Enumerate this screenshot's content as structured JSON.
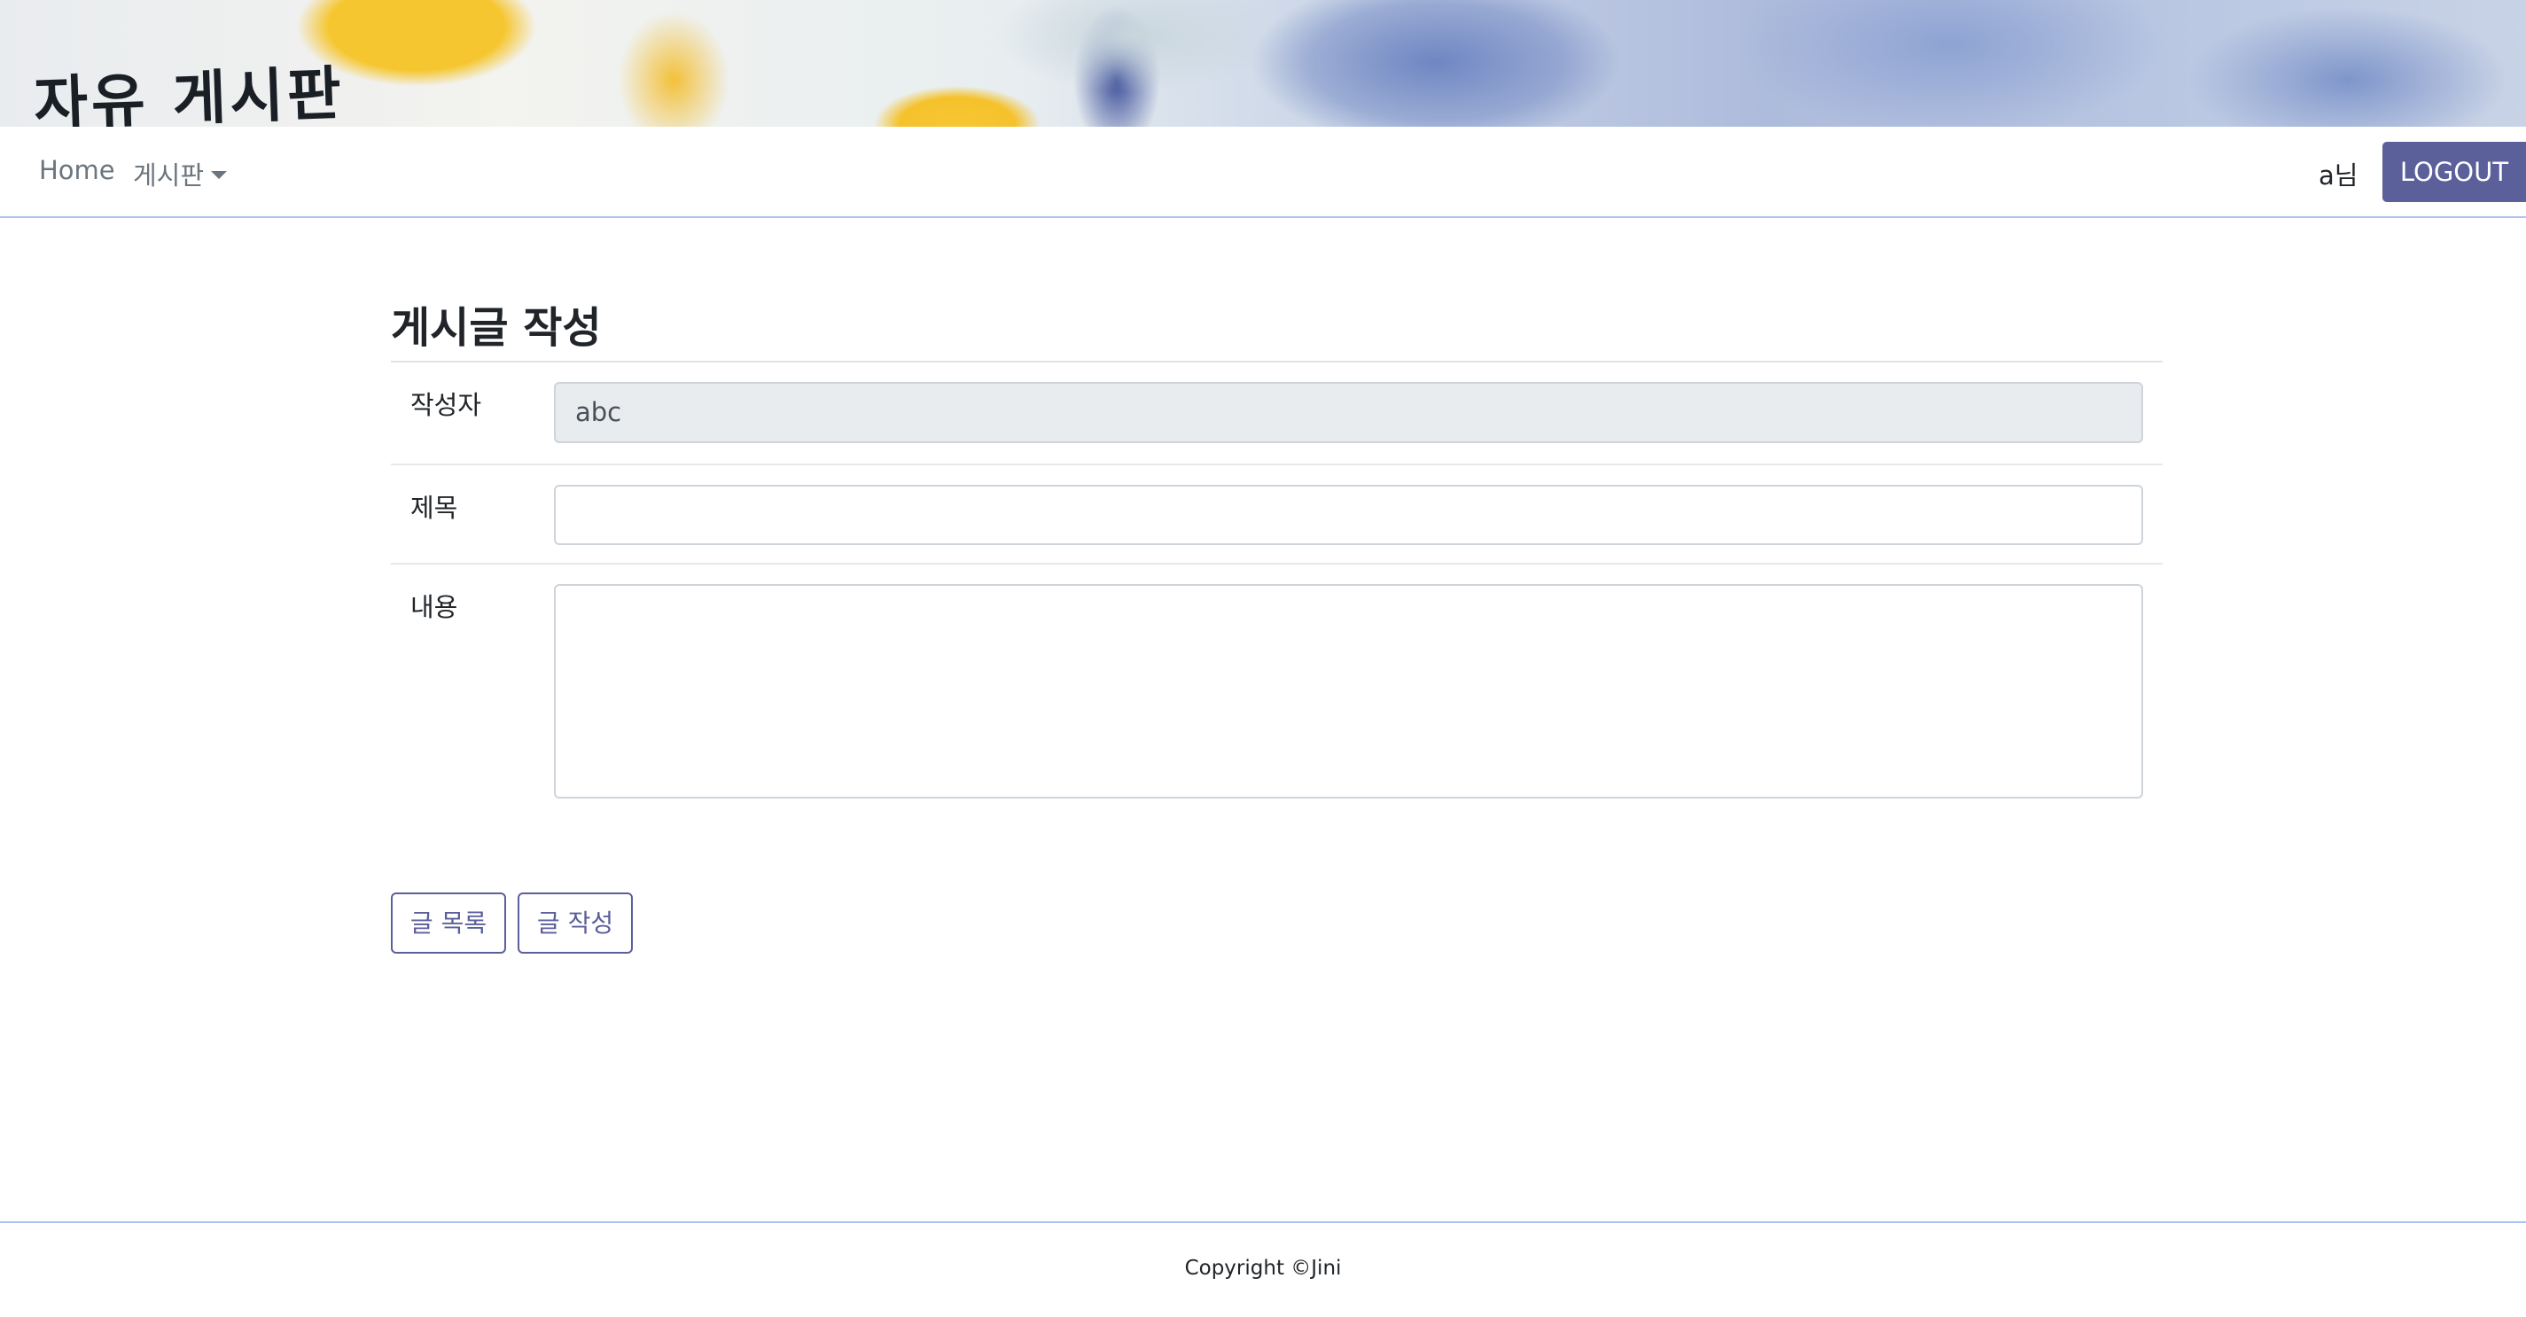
{
  "header": {
    "logo_text": "자유 게시판"
  },
  "nav": {
    "home_label": "Home",
    "board_label": "게시판",
    "user_label": "a님",
    "logout_label": "LOGOUT"
  },
  "form": {
    "title": "게시글 작성",
    "writer_label": "작성자",
    "writer_value": "abc",
    "subject_label": "제목",
    "subject_value": "",
    "content_label": "내용",
    "content_value": ""
  },
  "actions": {
    "list_label": "글 목록",
    "write_label": "글 작성"
  },
  "footer": {
    "copyright": "Copyright ©Jini"
  },
  "colors": {
    "accent": "#5b5f9a",
    "divider": "#a9c4f0",
    "readonly_bg": "#e9ecef"
  }
}
